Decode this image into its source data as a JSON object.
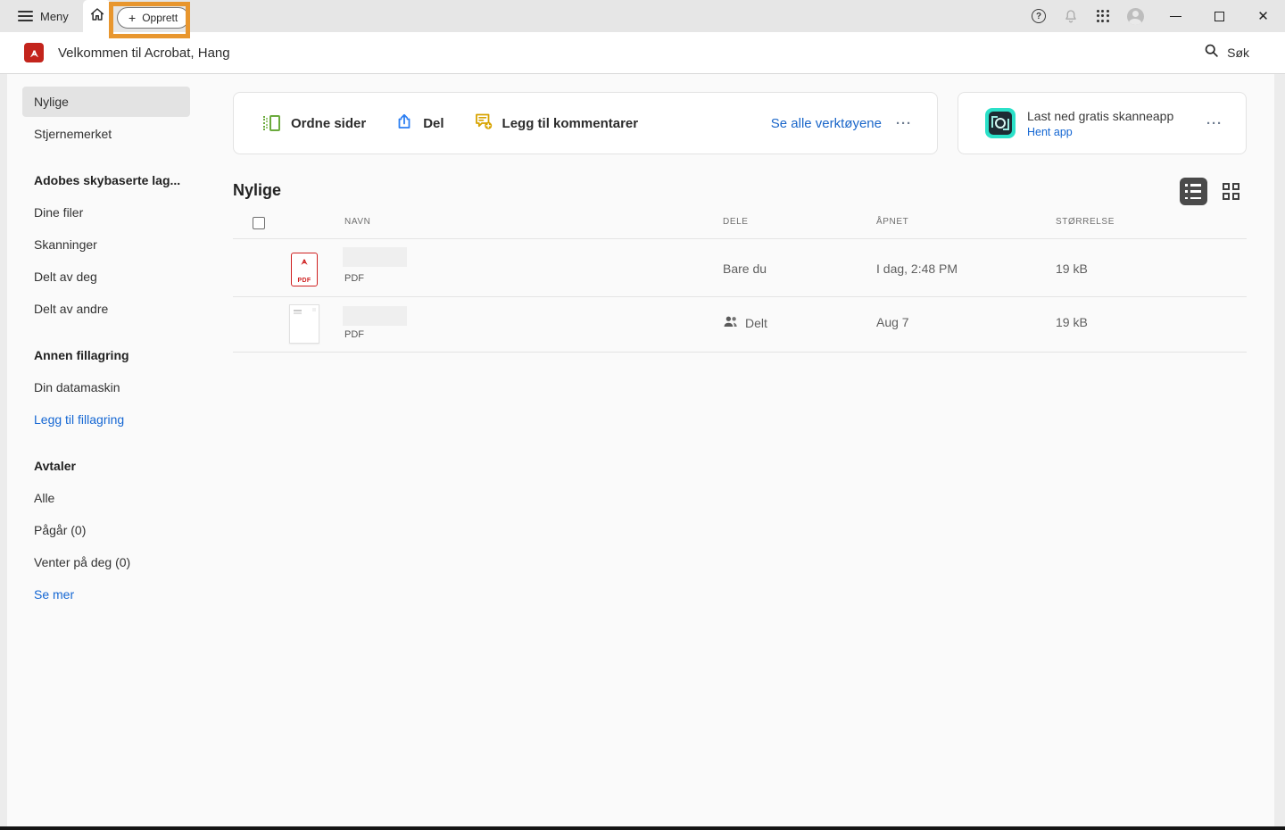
{
  "colors": {
    "accent_blue": "#1567d3",
    "highlight_orange": "#E8962E",
    "acrobat_red": "#c3241c",
    "scan_cyan": "#2BE0C8",
    "tool_green": "#6BAA3D",
    "tool_blue": "#2D7FF2",
    "tool_yellow": "#D7A300"
  },
  "topbar": {
    "menu_label": "Meny",
    "create_plus": "+",
    "create_label": "Opprett"
  },
  "welcome": {
    "title": "Velkommen til Acrobat, Hang",
    "search_label": "Søk"
  },
  "sidebar": {
    "sections": [
      {
        "items": [
          {
            "label": "Nylige"
          },
          {
            "label": "Stjernemerket"
          }
        ]
      },
      {
        "header": "Adobes skybaserte lag...",
        "items": [
          {
            "label": "Dine filer"
          },
          {
            "label": "Skanninger"
          },
          {
            "label": "Delt av deg"
          },
          {
            "label": "Delt av andre"
          }
        ]
      },
      {
        "header": "Annen fillagring",
        "items": [
          {
            "label": "Din datamaskin"
          },
          {
            "label": "Legg til fillagring"
          }
        ]
      },
      {
        "header": "Avtaler",
        "items": [
          {
            "label": "Alle"
          },
          {
            "label": "Pågår (0)"
          },
          {
            "label": "Venter på deg (0)"
          },
          {
            "label": "Se mer"
          }
        ]
      }
    ]
  },
  "tools_card": {
    "items": [
      {
        "label": "Ordne sider",
        "icon": "organize-pages-icon"
      },
      {
        "label": "Del",
        "icon": "share-icon"
      },
      {
        "label": "Legg til kommentarer",
        "icon": "add-comment-icon"
      }
    ],
    "see_all_label": "Se alle verktøyene",
    "more_label": "···"
  },
  "scan_card": {
    "title": "Last ned gratis skanneapp",
    "link_label": "Hent app",
    "more_label": "···"
  },
  "recent": {
    "title": "Nylige",
    "columns": {
      "name": "NAVN",
      "share": "DELE",
      "opened": "ÅPNET",
      "size": "STØRRELSE"
    },
    "rows": [
      {
        "file_type": "PDF",
        "share_status": "Bare du",
        "opened": "I dag, 2:48 PM",
        "size": "19 kB"
      },
      {
        "file_type": "PDF",
        "share_status": "Delt",
        "opened": "Aug 7",
        "size": "19 kB"
      }
    ]
  }
}
